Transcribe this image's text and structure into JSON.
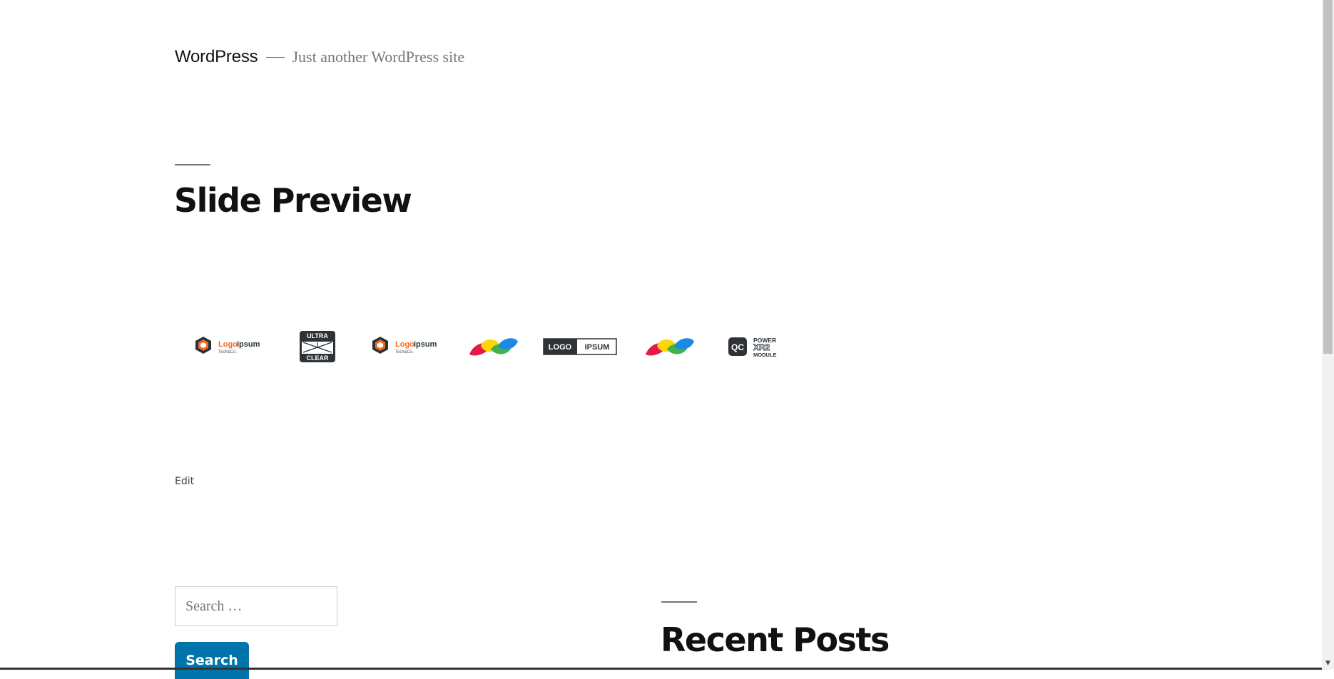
{
  "site": {
    "title": "WordPress",
    "description": "Just another WordPress site"
  },
  "article": {
    "title": "Slide Preview",
    "edit_label": "Edit"
  },
  "logo_slider": {
    "logos": [
      {
        "name": "logoipsum-hexagon-logo",
        "text_main_a": "Logo",
        "text_main_b": "ipsum",
        "text_sub": "Tech&Co."
      },
      {
        "name": "ultra-clear-logo",
        "text_top": "ULTRA",
        "text_bottom": "CLEAR"
      },
      {
        "name": "logoipsum-hexagon-logo",
        "text_main_a": "Logo",
        "text_main_b": "ipsum",
        "text_sub": "Tech&Co."
      },
      {
        "name": "colorful-leaves-logo"
      },
      {
        "name": "logo-ipsum-boxed-logo",
        "text_a": "LOGO",
        "text_b": "IPSUM"
      },
      {
        "name": "colorful-leaves-logo"
      },
      {
        "name": "qc-power-module-logo",
        "text_badge": "QC",
        "text_1": "POWER",
        "text_2": "XR2",
        "text_3": "MODULE"
      }
    ]
  },
  "search": {
    "placeholder": "Search …",
    "button_label": "Search"
  },
  "recent_posts": {
    "title": "Recent Posts"
  },
  "colors": {
    "accent": "#0073aa",
    "logo_orange": "#f26b22",
    "logo_dark": "#263238"
  }
}
